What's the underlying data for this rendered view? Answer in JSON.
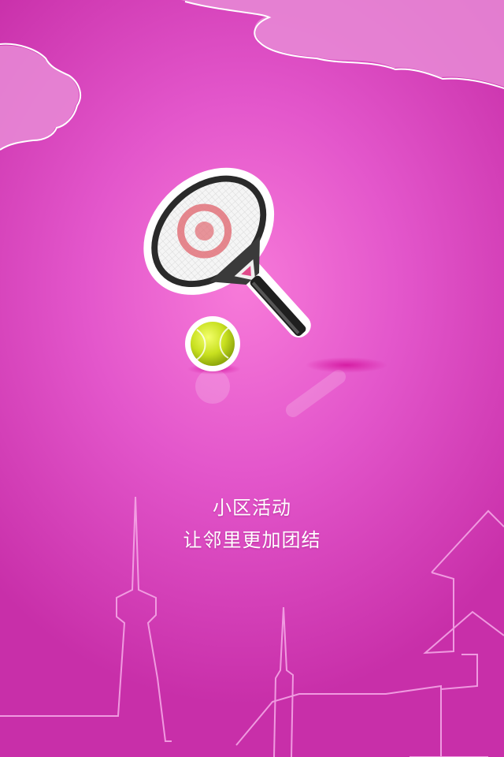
{
  "splash": {
    "title_line": "小区活动",
    "subtitle_line": "让邻里更加团结"
  },
  "illustration": {
    "racket": "tennis-racket-icon",
    "ball": "tennis-ball-icon"
  },
  "colors": {
    "background_center": "#f77ad9",
    "background_edge": "#c82fa9",
    "cloud": "#e88bd6",
    "text": "#ffffff",
    "ball": "#c8e01f"
  }
}
